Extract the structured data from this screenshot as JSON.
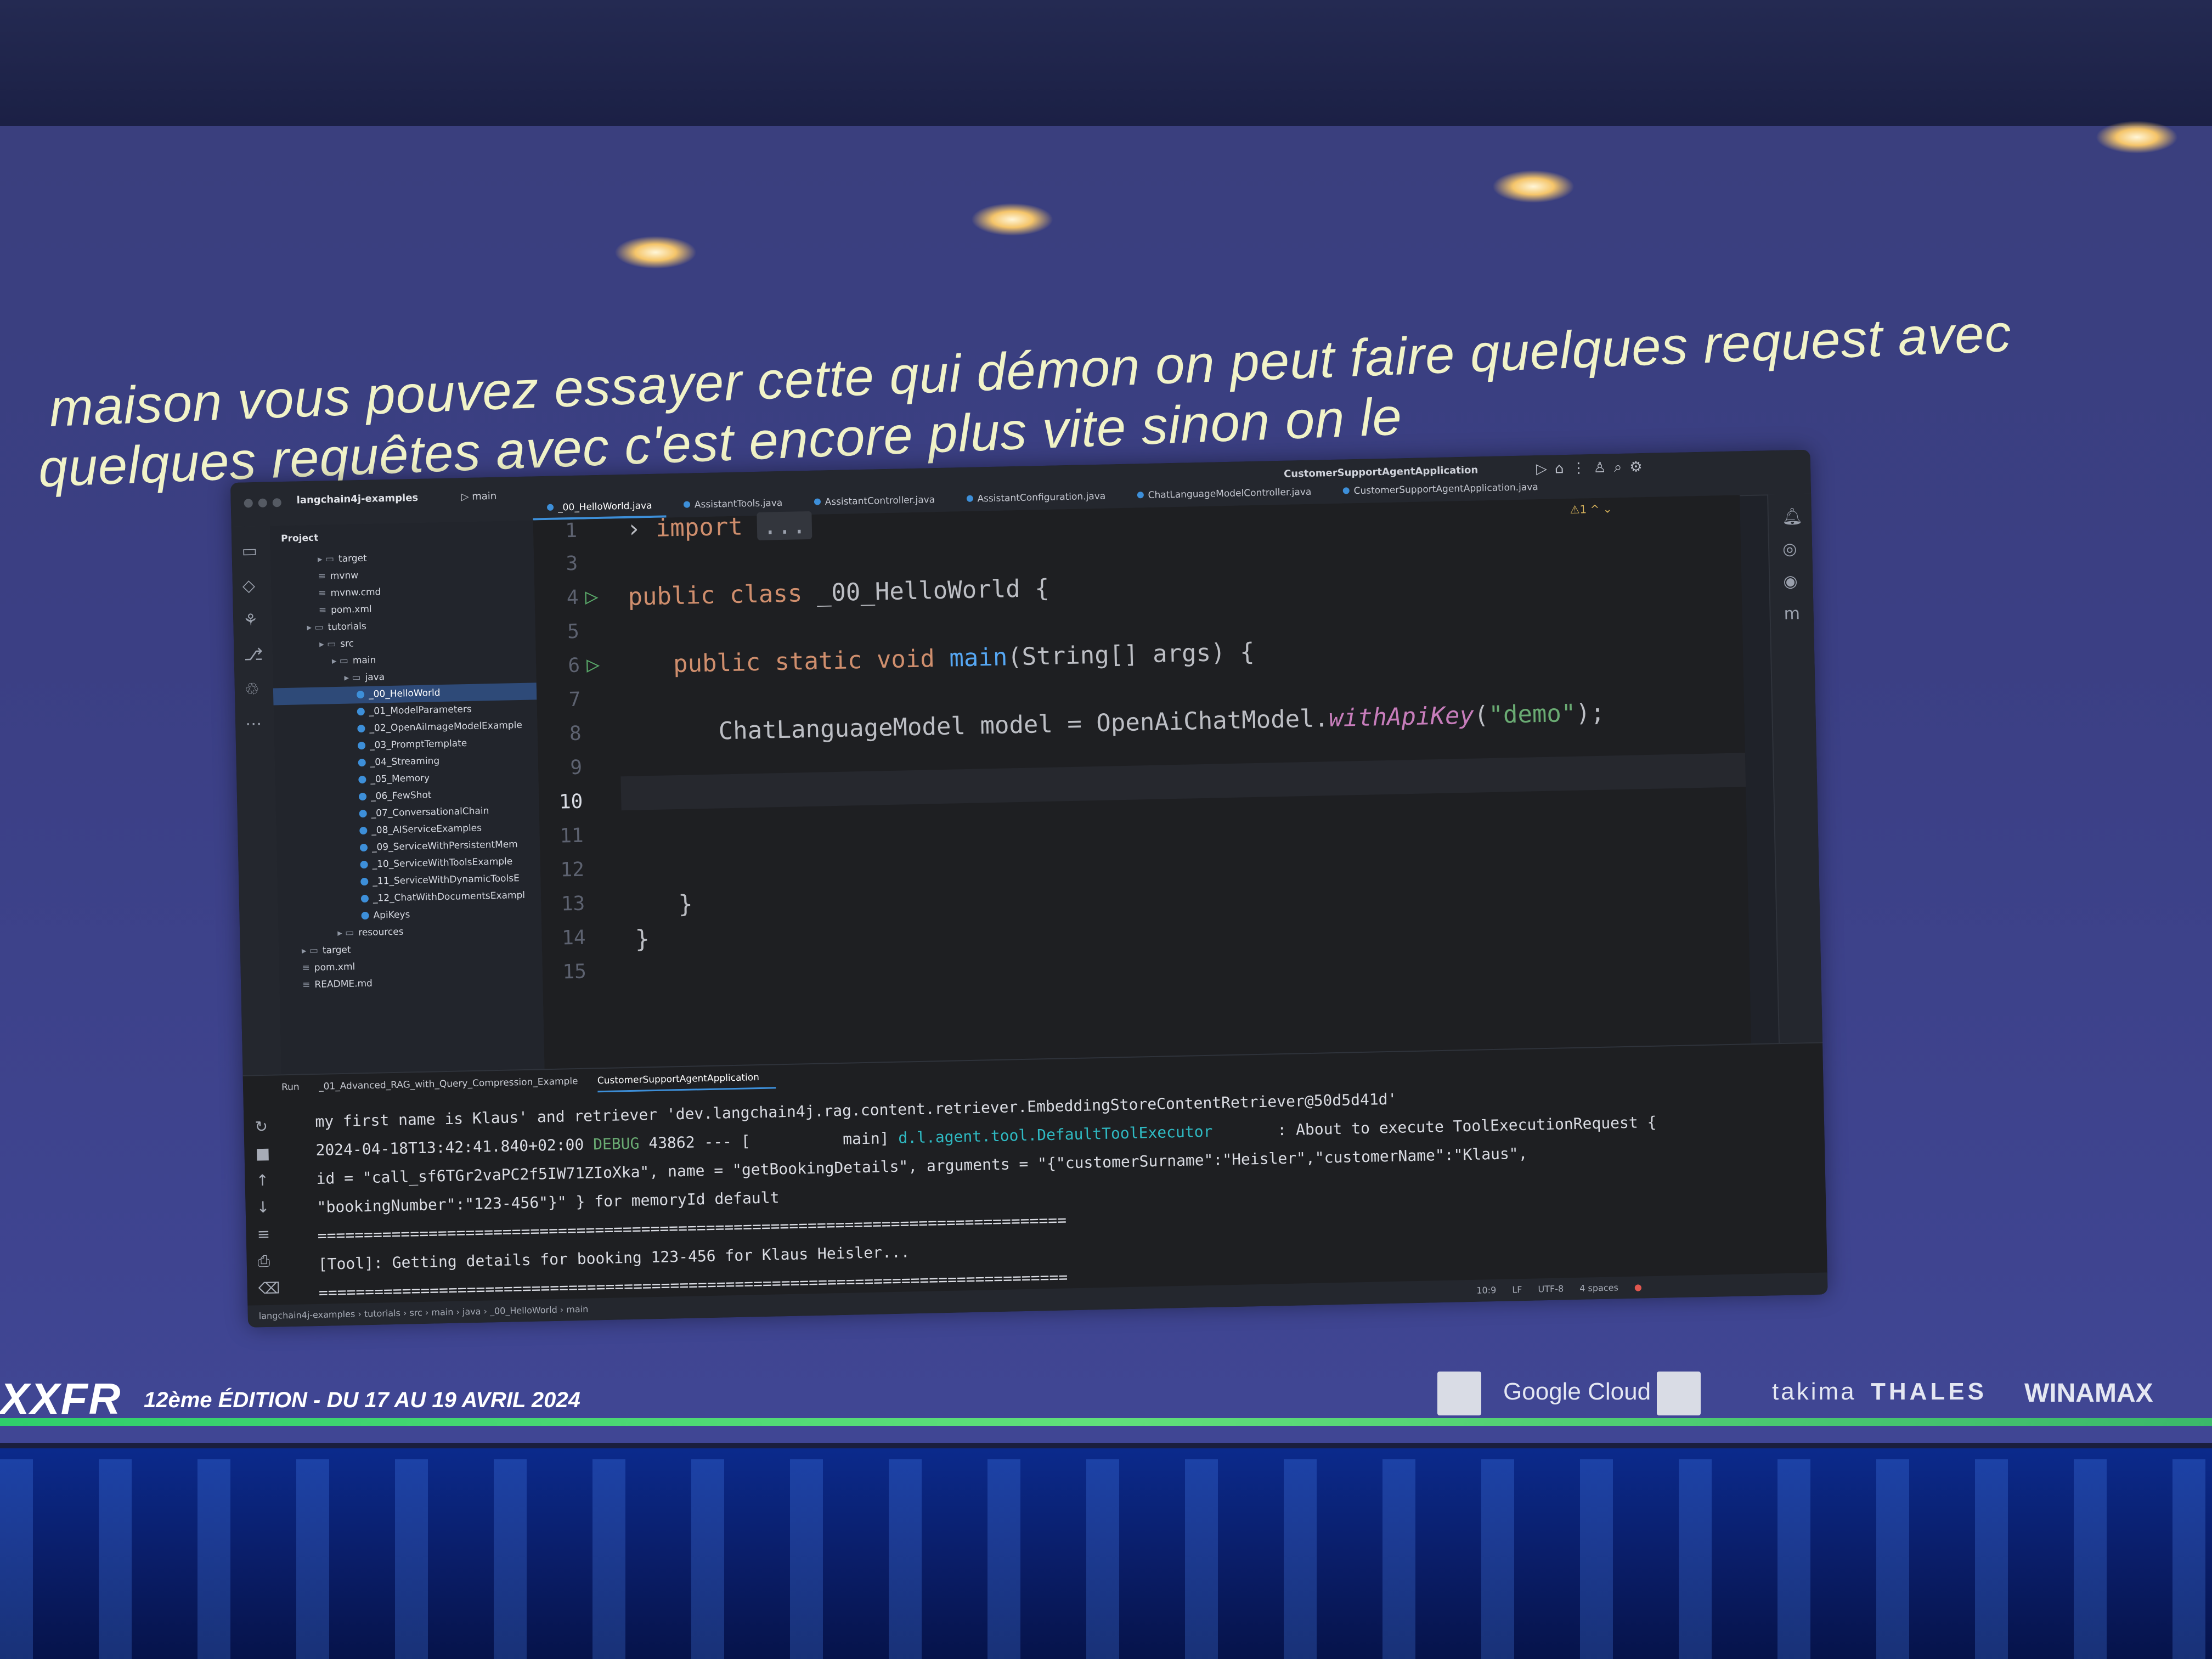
{
  "subtitles": {
    "line1": "maison vous pouvez essayer cette qui démon on peut faire quelques request avec",
    "line2": "quelques requêtes avec c'est encore plus vite sinon on le"
  },
  "ide": {
    "project_name": "langchain4j-examples",
    "branch": "main",
    "run_config": "CustomerSupportAgentApplication",
    "project_label": "Project",
    "tree": [
      {
        "label": "target",
        "type": "folder",
        "indent": 3
      },
      {
        "label": "mvnw",
        "type": "file",
        "indent": 3
      },
      {
        "label": "mvnw.cmd",
        "type": "file",
        "indent": 3
      },
      {
        "label": "pom.xml",
        "type": "file",
        "indent": 3
      },
      {
        "label": "tutorials",
        "type": "folder",
        "indent": 2
      },
      {
        "label": "src",
        "type": "folder",
        "indent": 3
      },
      {
        "label": "main",
        "type": "folder",
        "indent": 4
      },
      {
        "label": "java",
        "type": "folder",
        "indent": 5
      },
      {
        "label": "_00_HelloWorld",
        "type": "java",
        "indent": 6,
        "selected": true
      },
      {
        "label": "_01_ModelParameters",
        "type": "java",
        "indent": 6
      },
      {
        "label": "_02_OpenAiImageModelExample",
        "type": "java",
        "indent": 6
      },
      {
        "label": "_03_PromptTemplate",
        "type": "java",
        "indent": 6
      },
      {
        "label": "_04_Streaming",
        "type": "java",
        "indent": 6
      },
      {
        "label": "_05_Memory",
        "type": "java",
        "indent": 6
      },
      {
        "label": "_06_FewShot",
        "type": "java",
        "indent": 6
      },
      {
        "label": "_07_ConversationalChain",
        "type": "java",
        "indent": 6
      },
      {
        "label": "_08_AIServiceExamples",
        "type": "java",
        "indent": 6
      },
      {
        "label": "_09_ServiceWithPersistentMem",
        "type": "java",
        "indent": 6
      },
      {
        "label": "_10_ServiceWithToolsExample",
        "type": "java",
        "indent": 6
      },
      {
        "label": "_11_ServiceWithDynamicToolsE",
        "type": "java",
        "indent": 6
      },
      {
        "label": "_12_ChatWithDocumentsExampl",
        "type": "java",
        "indent": 6
      },
      {
        "label": "ApiKeys",
        "type": "java",
        "indent": 6
      },
      {
        "label": "resources",
        "type": "folder",
        "indent": 4
      },
      {
        "label": "target",
        "type": "folder",
        "indent": 1
      },
      {
        "label": "pom.xml",
        "type": "file",
        "indent": 1
      },
      {
        "label": "README.md",
        "type": "file",
        "indent": 1
      }
    ],
    "tabs": [
      {
        "label": "_00_HelloWorld.java",
        "active": true
      },
      {
        "label": "AssistantTools.java"
      },
      {
        "label": "AssistantController.java"
      },
      {
        "label": "AssistantConfiguration.java"
      },
      {
        "label": "ChatLanguageModelController.java"
      },
      {
        "label": "CustomerSupportAgentApplication.java"
      }
    ],
    "editor_status": "⚠1 ^ ⌄",
    "code": {
      "ln1": "1",
      "ln3": "3",
      "ln4": "4",
      "ln5": "5",
      "ln6": "6",
      "ln7": "7",
      "ln8": "8",
      "ln9": "9",
      "ln10": "10",
      "ln11": "11",
      "ln12": "12",
      "ln13": "13",
      "ln14": "14",
      "ln15": "15",
      "import_kw": "import",
      "import_fold": "...",
      "class_kw": "public class",
      "class_name": "_00_HelloWorld {",
      "main_kw": "public static void",
      "main_fn": "main",
      "main_args": "(String[] args) {",
      "model_type": "ChatLanguageModel",
      "model_var": "model",
      "model_eq": "=",
      "model_call_cls": "OpenAiChatModel.",
      "model_call_fn": "withApiKey",
      "model_arg": "\"demo\"",
      "model_end": ");",
      "close1": "}",
      "close2": "}"
    },
    "run_panel": {
      "run_label": "Run",
      "tab1": "_01_Advanced_RAG_with_Query_Compression_Example",
      "tab2": "CustomerSupportAgentApplication",
      "log1": "my first name is Klaus' and retriever 'dev.langchain4j.rag.content.retriever.EmbeddingStoreContentRetriever@50d5d41d'",
      "log2_time": "2024-04-18T13:42:41.840+02:00",
      "log2_level": "DEBUG",
      "log2_pid": "43862 --- [",
      "log2_thread": "main]",
      "log2_logger": "d.l.agent.tool.DefaultToolExecutor",
      "log2_msg": ": About to execute ToolExecutionRequest {",
      "log3": "id = \"call_sf6TGr2vaPC2f5IW71ZIoXka\", name = \"getBookingDetails\", arguments = \"{\"customerSurname\":\"Heisler\",\"customerName\":\"Klaus\",",
      "log4": "\"bookingNumber\":\"123-456\"}\" } for memoryId default",
      "log5": "=================================================================================",
      "log6": "[Tool]: Getting details for booking 123-456 for Klaus Heisler...",
      "log7": "================================================================================="
    },
    "statusbar": {
      "crumbs": "langchain4j-examples › tutorials › src › main › java › _00_HelloWorld › main",
      "position": "10:9",
      "line_sep": "LF",
      "encoding": "UTF-8",
      "indent": "4 spaces"
    }
  },
  "banner": {
    "event": "XXFR",
    "edition": "12ème ÉDITION - DU 17 AU 19 AVRIL 2024",
    "sponsors": [
      "Google Cloud",
      "takima",
      "THALES",
      "WINAMAX"
    ]
  }
}
